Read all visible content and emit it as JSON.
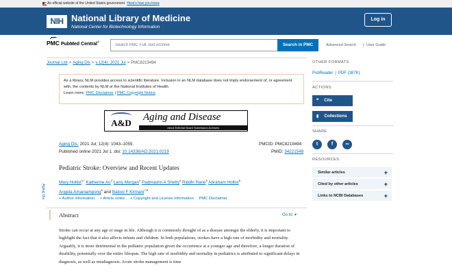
{
  "gov_banner": {
    "text": "An official website of the United States government",
    "link": "Here's how you know"
  },
  "header": {
    "logo": "NIH",
    "title": "National Library of Medicine",
    "subtitle": "National Center for Biotechnology Information",
    "login": "Log in"
  },
  "pmc": {
    "logo_mark": "PMC",
    "logo_rest": "PubMed Central",
    "logo_reg": "®",
    "search_placeholder": "Search PMC Full-Text Archive",
    "search_button": "Search in PMC",
    "advanced_search": "Advanced Search",
    "separator": "|",
    "user_guide": "User Guide"
  },
  "breadcrumb": {
    "items": [
      "Journal List",
      "Aging Dis",
      "v.12(4); 2021 Jul"
    ],
    "current": "PMC8219494",
    "sep": ">"
  },
  "disclaimer": {
    "text": "As a library, NLM provides access to scientific literature. Inclusion in an NLM database does not imply endorsement of, or agreement with, the contents by NLM or the National Institutes of Health.",
    "learn_more": "Learn more:",
    "link1": "PMC Disclaimer",
    "sep": "|",
    "link2": "PMC Copyright Notice"
  },
  "journal_banner": {
    "logo": "A&D",
    "title": "Aging and Disease",
    "strip": "About   Editorial Board   Submission   Archives"
  },
  "citation": {
    "journal": "Aging Dis.",
    "info": "2021 Jul; 12(4): 1043–1055.",
    "published": "Published online 2021 Jul 1. doi:",
    "doi": "10.14336/AD.2021.0219",
    "pmcid_label": "PMCID: PMC8219494",
    "pmid_label": "PMID:",
    "pmid": "34221548",
    "side_label": "Aging Dis"
  },
  "article": {
    "title": "Pediatric Stroke: Overview and Recent Updates",
    "authors": [
      {
        "name": "Mary Hollist",
        "sup": "1,*"
      },
      {
        "name": "Katherine Au",
        "sup": "2"
      },
      {
        "name": "Larry Morgan",
        "sup": "3"
      },
      {
        "name": "Padmashri A Shetty",
        "sup": "4"
      },
      {
        "name": "Riddhi Rane",
        "sup": "5"
      },
      {
        "name": "Abraham Hollist",
        "sup": "6"
      },
      {
        "name": "Angela Amaniampong",
        "sup": "6"
      },
      {
        "name": "Batool F Kirmani",
        "sup": "7,8"
      }
    ],
    "and_text": "and",
    "meta_links": [
      "+ Author information",
      "+ Article notes",
      "+ Copyright and License information",
      "PMC Disclaimer"
    ]
  },
  "abstract": {
    "heading": "Abstract",
    "goto": "Go to: ▾",
    "text": "Stroke can occur at any age or stage in life. Although it is commonly thought of as a disease amongst the elderly, it is important to highlight the fact that it also affects infants and children. In both populations, strokes have a high rate of morbidity and mortality. Arguably, it is more detrimental in the pediatric population given the occurrence at a younger age and therefore, a longer duration of disability, potentially over the entire lifespan. The high rate of morbidity and mortality in pediatrics is attributed to significant delays in diagnosis, as well as misdiagnosis. Acute stroke management is time"
  },
  "sidebar": {
    "other_formats": "OTHER FORMATS",
    "pubreader": "PubReader",
    "pdf": "PDF (387K)",
    "fsep": "|",
    "actions": "ACTIONS",
    "cite": "Cite",
    "collections": "Collections",
    "share": "SHARE",
    "resources": "RESOURCES",
    "resource_items": [
      "Similar articles",
      "Cited by other articles",
      "Links to NCBI Databases"
    ],
    "icons": {
      "cite": "quote-icon",
      "collections": "bookmark-icon",
      "twitter": "twitter-icon",
      "facebook": "facebook-icon",
      "link": "link-icon"
    },
    "colors": {
      "accent": "#20558a",
      "link": "#0071bc",
      "resource_bg": "#eef4f9"
    }
  }
}
